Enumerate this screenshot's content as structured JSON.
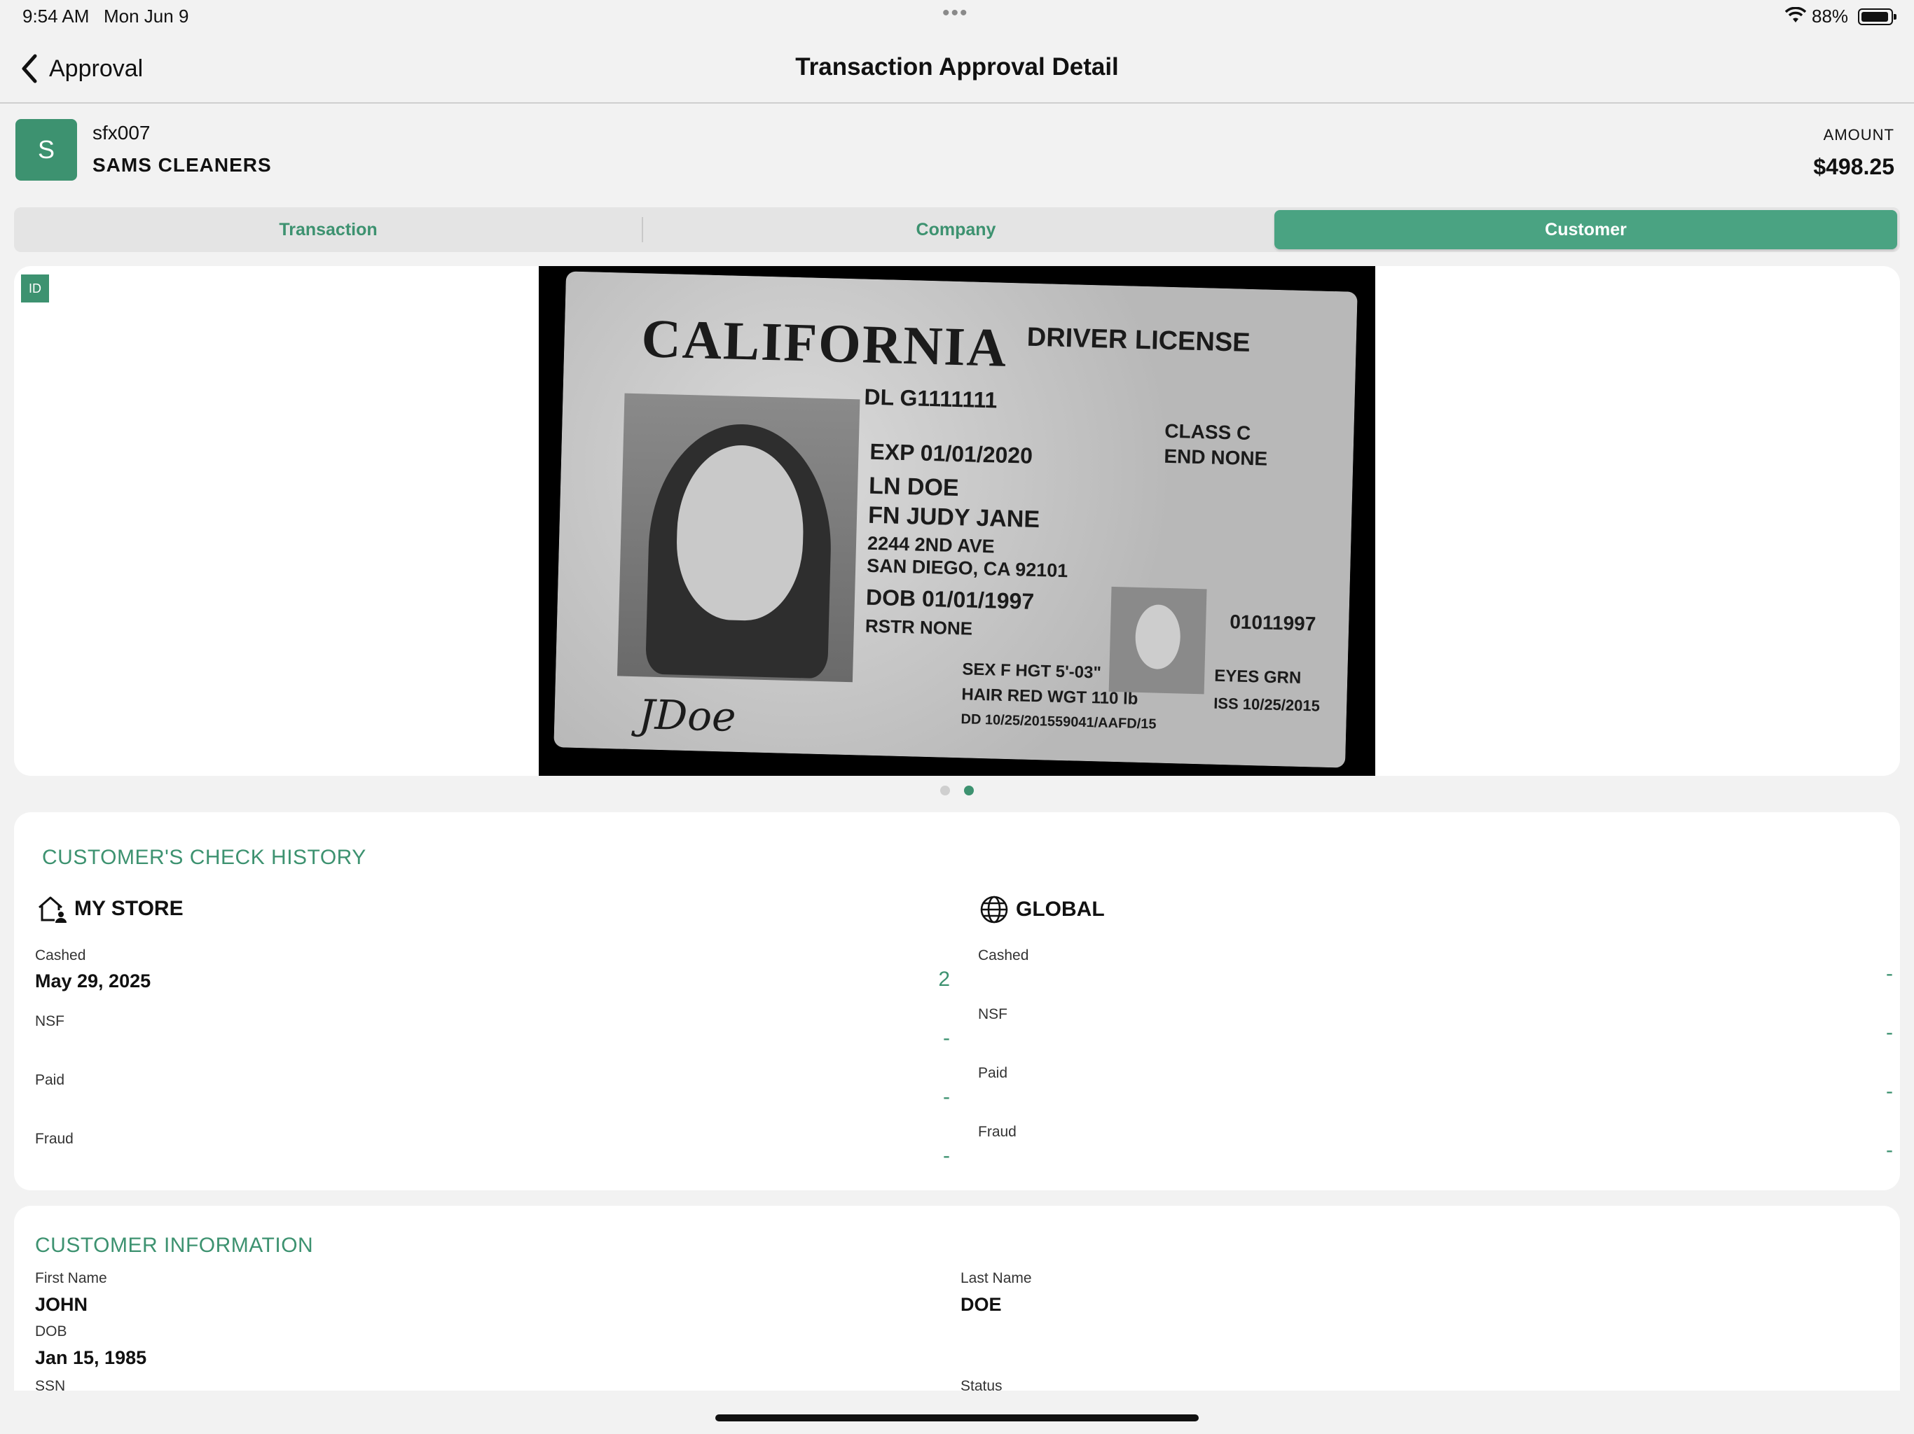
{
  "status": {
    "time": "9:54 AM",
    "date": "Mon Jun 9",
    "dots": "•••",
    "battery": "88%",
    "battery_level": 0.88
  },
  "nav": {
    "back_label": "Approval",
    "title": "Transaction Approval Detail"
  },
  "merchant": {
    "avatar_letter": "S",
    "id": "sfx007",
    "name": "SAMS CLEANERS",
    "amount_label": "AMOUNT",
    "amount": "$498.25"
  },
  "tabs": [
    {
      "label": "Transaction",
      "selected": false
    },
    {
      "label": "Company",
      "selected": false
    },
    {
      "label": "Customer",
      "selected": true
    }
  ],
  "image_card": {
    "badge": "ID",
    "page_count": 2,
    "current_page": 2,
    "license": {
      "state": "CALIFORNIA",
      "doc_type": "DRIVER LICENSE",
      "dl": "DL  G1111111",
      "class": "CLASS C",
      "end": "END NONE",
      "exp": "EXP 01/01/2020",
      "ln": "LN DOE",
      "fn": "FN JUDY JANE",
      "address1": "2244 2ND AVE",
      "address2": "SAN DIEGO, CA 92101",
      "dob": "DOB 01/01/1997",
      "rstr": "RSTR NONE",
      "number_right": "01011997",
      "sex_hgt": "SEX F   HGT 5'-03\"",
      "hair_wgt": "HAIR RED   WGT 110 lb",
      "eyes": "EYES GRN",
      "iss": "ISS 10/25/2015",
      "dd": "DD 10/25/201559041/AAFD/15",
      "signature": "JDoe"
    }
  },
  "history": {
    "title": "CUSTOMER'S CHECK HISTORY",
    "my_store": {
      "heading": "MY STORE",
      "icon": "home-person-icon",
      "rows": [
        {
          "label": "Cashed",
          "date": "May 29, 2025",
          "value": "2"
        },
        {
          "label": "NSF",
          "date": "",
          "value": "-"
        },
        {
          "label": "Paid",
          "date": "",
          "value": "-"
        },
        {
          "label": "Fraud",
          "date": "",
          "value": "-"
        }
      ]
    },
    "global": {
      "heading": "GLOBAL",
      "icon": "globe-icon",
      "rows": [
        {
          "label": "Cashed",
          "value": "-"
        },
        {
          "label": "NSF",
          "value": "-"
        },
        {
          "label": "Paid",
          "value": "-"
        },
        {
          "label": "Fraud",
          "value": "-"
        }
      ]
    }
  },
  "customer_info": {
    "title": "CUSTOMER INFORMATION",
    "first_name_label": "First Name",
    "first_name": "JOHN",
    "last_name_label": "Last Name",
    "last_name": "DOE",
    "dob_label": "DOB",
    "dob": "Jan 15, 1985",
    "ssn_label": "SSN",
    "status_label": "Status"
  },
  "colors": {
    "accent": "#3d9270",
    "accent_selected": "#4aa382",
    "background": "#f2f2f2",
    "card": "#ffffff"
  }
}
